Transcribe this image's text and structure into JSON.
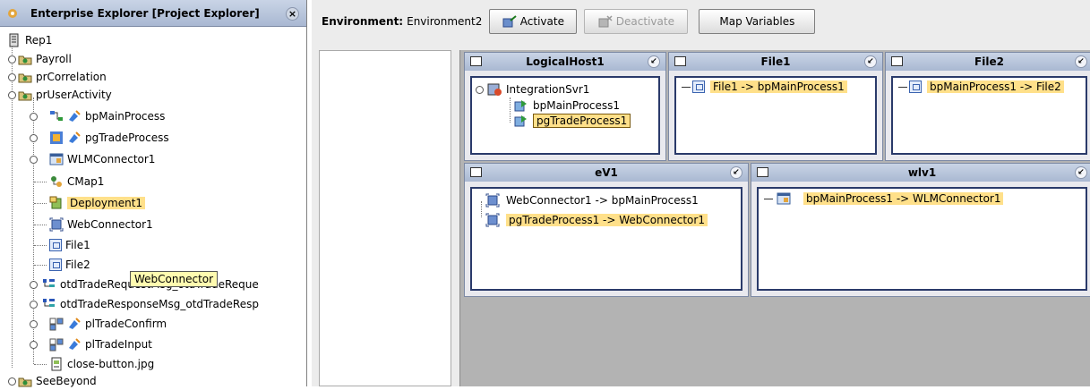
{
  "explorer": {
    "title": "Enterprise Explorer [Project Explorer]",
    "close_glyph": "×",
    "tree": [
      {
        "label": "Rep1",
        "icon": "repository-icon"
      },
      {
        "label": "Payroll",
        "icon": "project-folder-icon"
      },
      {
        "label": "prCorrelation",
        "icon": "project-folder-icon"
      },
      {
        "label": "prUserActivity",
        "icon": "project-folder-icon"
      },
      {
        "label": "bpMainProcess",
        "icon": "business-process-icon"
      },
      {
        "label": "pgTradeProcess",
        "icon": "process-graph-icon"
      },
      {
        "label": "WLMConnector1",
        "icon": "connector-icon"
      },
      {
        "label": "CMap1",
        "icon": "connectivity-map-icon"
      },
      {
        "label": "Deployment1",
        "icon": "deployment-icon"
      },
      {
        "label": "WebConnector1",
        "icon": "web-connector-icon"
      },
      {
        "label": "File1",
        "icon": "file-icon"
      },
      {
        "label": "File2",
        "icon": "file-icon"
      },
      {
        "label": "otdTradeRequestMsg_otdTradeReque",
        "icon": "otd-icon"
      },
      {
        "label": "otdTradeResponseMsg_otdTradeResp",
        "icon": "otd-icon"
      },
      {
        "label": "plTradeConfirm",
        "icon": "partner-link-icon"
      },
      {
        "label": "plTradeInput",
        "icon": "partner-link-icon"
      },
      {
        "label": "close-button.jpg",
        "icon": "image-file-icon"
      },
      {
        "label": "SeeBeyond",
        "icon": "project-folder-icon"
      }
    ],
    "tooltip": "WebConnector"
  },
  "toolbar": {
    "environment_label": "Environment:",
    "environment_value": "Environment2",
    "activate_label": "Activate",
    "deactivate_label": "Deactivate",
    "map_variables_label": "Map Variables"
  },
  "panels": {
    "logicalhost": {
      "title": "LogicalHost1",
      "server": "IntegrationSvr1",
      "items": [
        "bpMainProcess1",
        "pgTradeProcess1"
      ]
    },
    "file1": {
      "title": "File1",
      "item": "File1 -> bpMainProcess1"
    },
    "file2": {
      "title": "File2",
      "item": "bpMainProcess1 -> File2"
    },
    "ev1": {
      "title": "eV1",
      "items": [
        "WebConnector1 -> bpMainProcess1",
        "pgTradeProcess1 -> WebConnector1"
      ]
    },
    "wlv1": {
      "title": "wlv1",
      "item": "bpMainProcess1 -> WLMConnector1"
    }
  },
  "colors": {
    "highlight": "#ffe08a",
    "title_bar": "#b7c4dc",
    "panel_border": "#2a3a6a"
  }
}
